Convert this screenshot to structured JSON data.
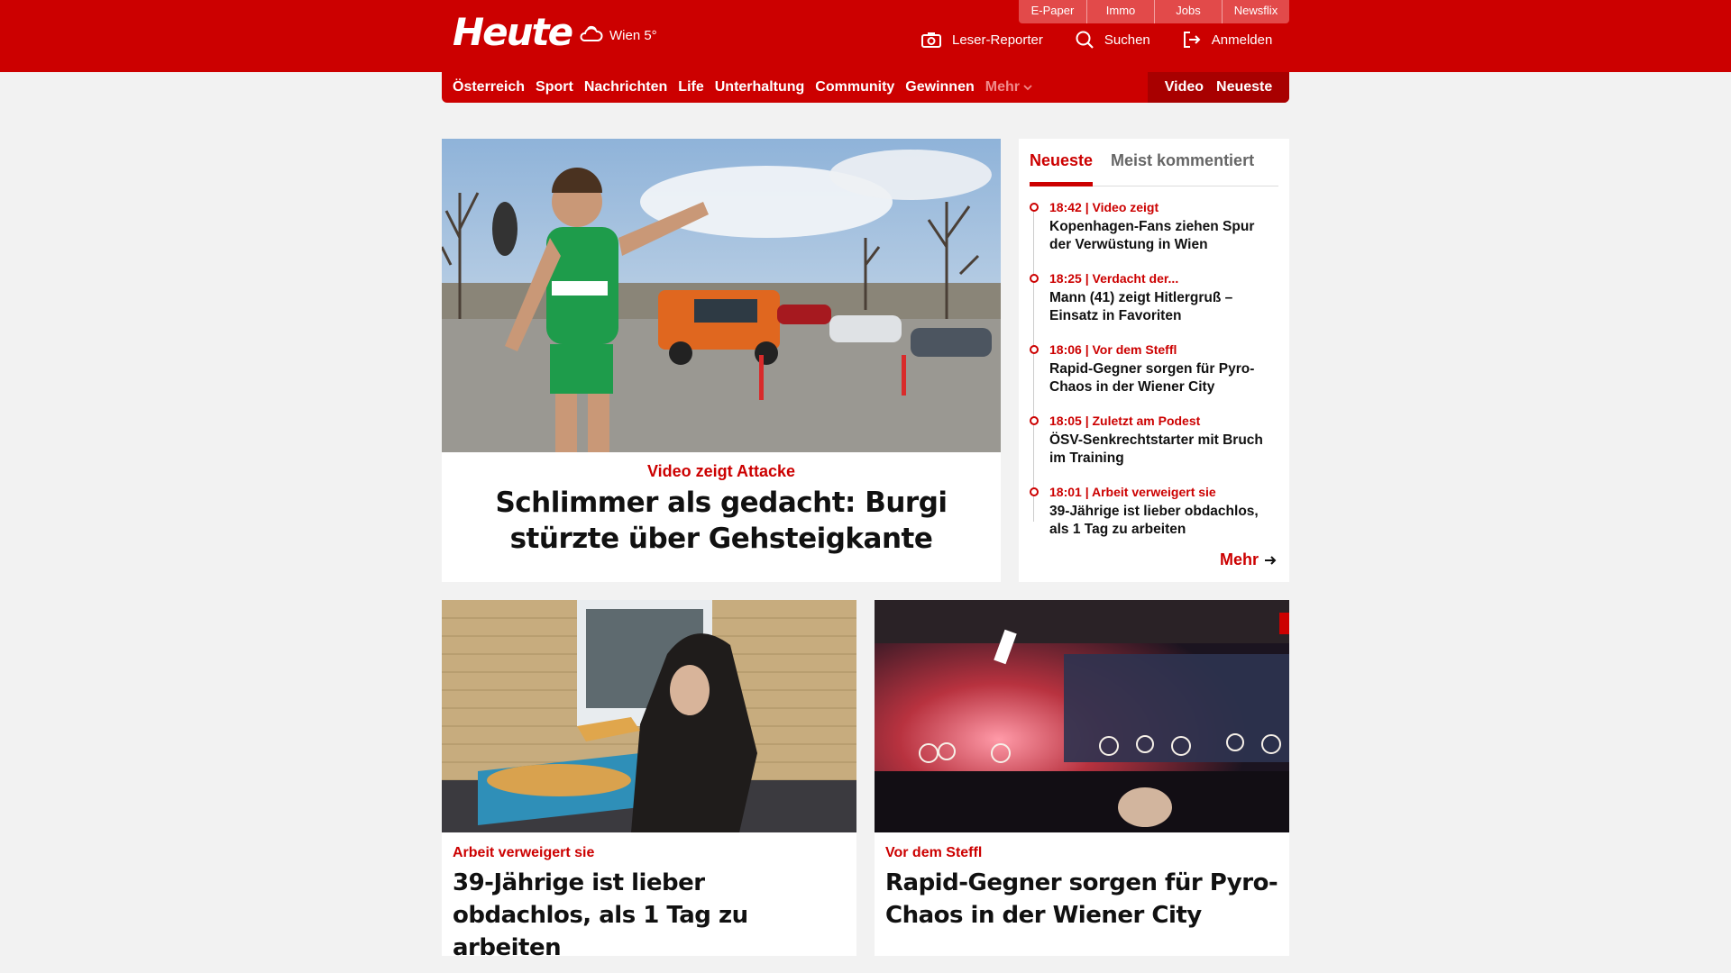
{
  "top_links": [
    "E-Paper",
    "Immo",
    "Jobs",
    "Newsflix"
  ],
  "logo": "Heute",
  "weather": "Wien 5°",
  "header_actions": {
    "reporter": "Leser-Reporter",
    "search": "Suchen",
    "login": "Anmelden"
  },
  "nav": {
    "items": [
      "Österreich",
      "Sport",
      "Nachrichten",
      "Life",
      "Unterhaltung",
      "Community",
      "Gewinnen"
    ],
    "more": "Mehr",
    "video": "Video",
    "latest": "Neueste"
  },
  "hero": {
    "kicker": "Video zeigt Attacke",
    "title": "Schlimmer als gedacht: Burgi stürzte über Gehsteigkante"
  },
  "sidebar": {
    "tabs": [
      "Neueste",
      "Meist kommentiert"
    ],
    "items": [
      {
        "meta": "18:42 | Video zeigt",
        "title": "Kopenhagen-Fans ziehen Spur der Verwüstung in Wien"
      },
      {
        "meta": "18:25 | Verdacht der...",
        "title": "Mann (41) zeigt Hitlergruß – Einsatz in Favoriten"
      },
      {
        "meta": "18:06 | Vor dem Steffl",
        "title": "Rapid-Gegner sorgen für Pyro-Chaos in der Wiener City"
      },
      {
        "meta": "18:05 | Zuletzt am Podest",
        "title": "ÖSV-Senkrechtstarter mit Bruch im Training"
      },
      {
        "meta": "18:01 | Arbeit verweigert sie",
        "title": "39-Jährige ist lieber obdachlos, als 1 Tag zu arbeiten"
      }
    ],
    "more": "Mehr"
  },
  "articles": [
    {
      "kicker": "Arbeit verweigert sie",
      "title": "39-Jährige ist lieber obdachlos, als 1 Tag zu arbeiten"
    },
    {
      "kicker": "Vor dem Steffl",
      "title": "Rapid-Gegner sorgen für Pyro-Chaos in der Wiener City"
    }
  ],
  "colors": {
    "brand": "#cc0000",
    "background": "#f2f2f2"
  }
}
